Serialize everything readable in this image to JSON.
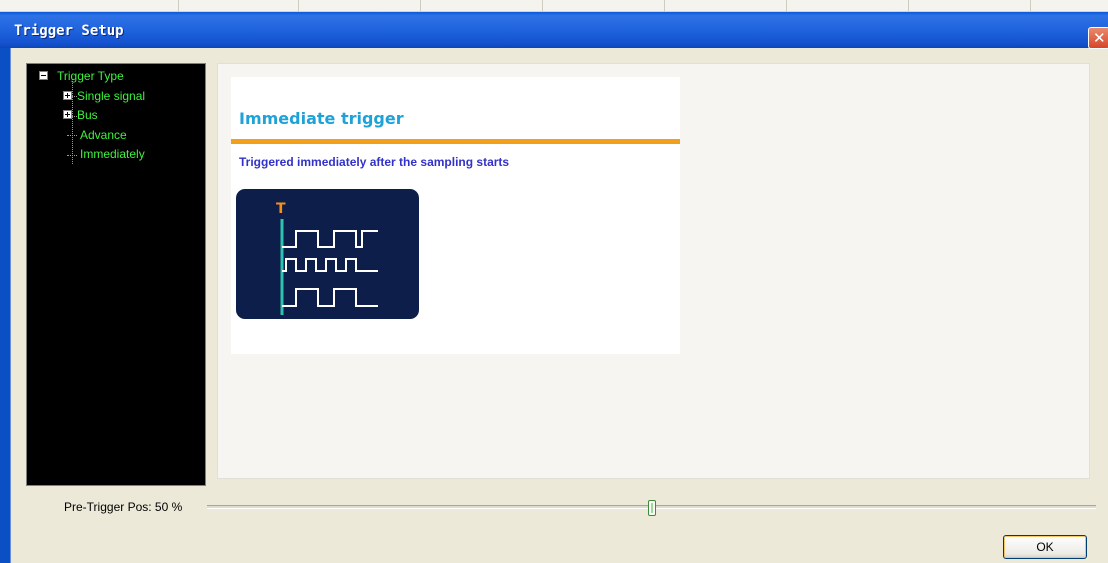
{
  "window": {
    "title": "Trigger Setup"
  },
  "tree": {
    "root": "Trigger Type",
    "items": [
      "Single signal",
      "Bus",
      "Advance",
      "Immediately"
    ]
  },
  "content": {
    "heading": "Immediate trigger",
    "description": "Triggered immediately after the sampling starts",
    "diagram": {
      "marker": "T",
      "background": "#0d1e4a",
      "signal_color": "#ffffff",
      "trigger_line_color": "#2ec3b0",
      "marker_color": "#f5901a"
    }
  },
  "slider": {
    "label": "Pre-Trigger Pos: 50 %",
    "value_percent": 50
  },
  "buttons": {
    "ok": "OK"
  },
  "colors": {
    "titlebar": "#1f63de",
    "tree_text": "#3df23d",
    "heading": "#1fa2d8",
    "rule": "#f0a01a",
    "description": "#3232c8"
  }
}
